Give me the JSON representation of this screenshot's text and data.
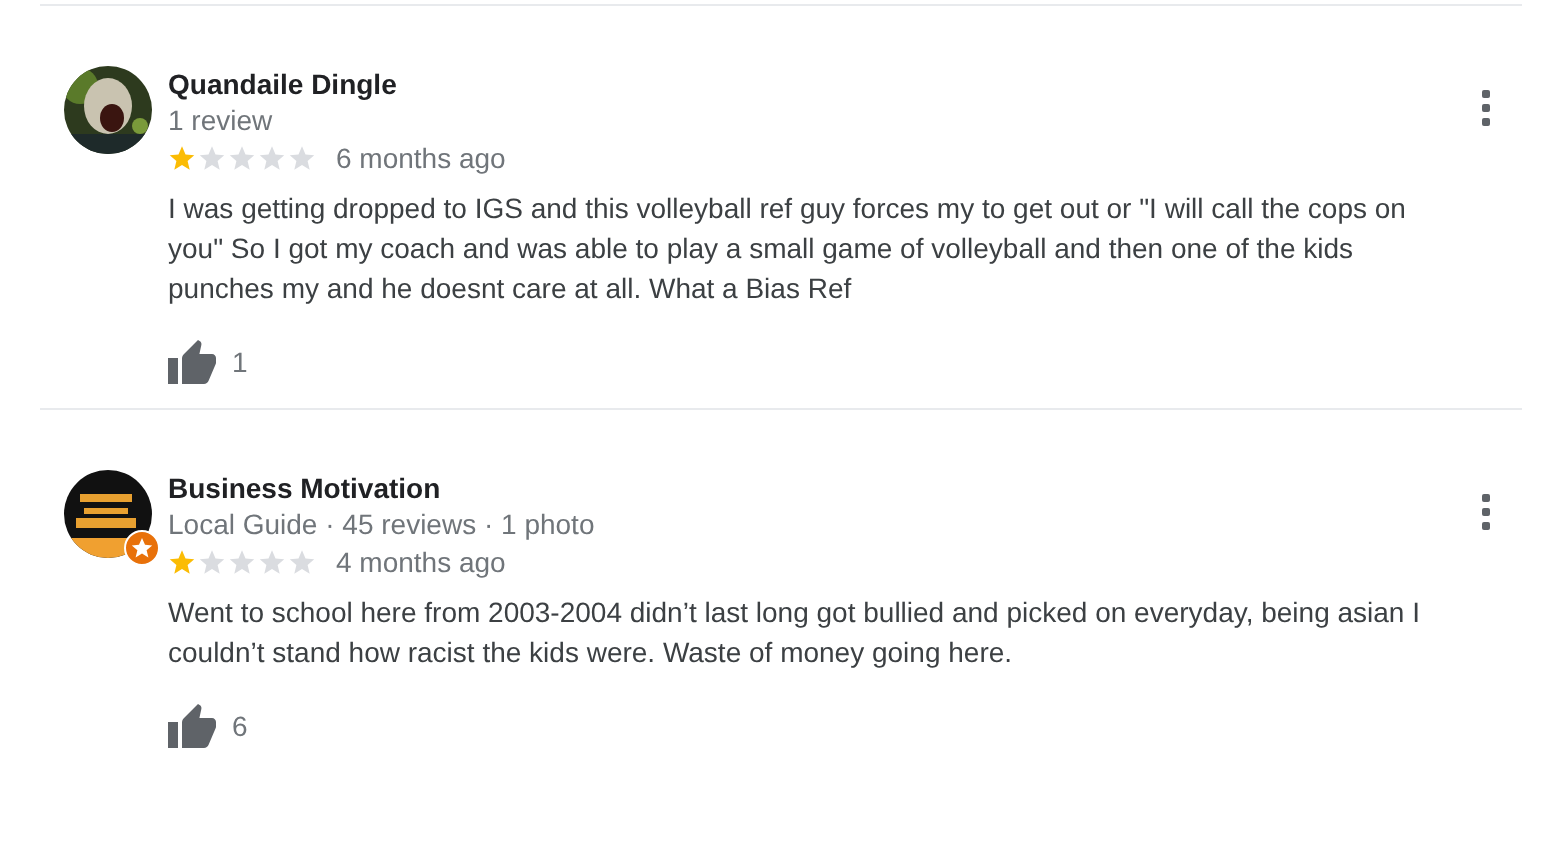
{
  "reviews": [
    {
      "author": "Quandaile Dingle",
      "meta": "1 review",
      "local_guide": false,
      "stars": 1,
      "time": "6 months ago",
      "text": "I was getting dropped to IGS and this volleyball ref guy forces my to get out or \"I will call the cops on you\" So I got my coach and was able to play a small game of volleyball and then one of the kids punches my and he doesnt care at all. What a Bias Ref",
      "likes": "1"
    },
    {
      "author": "Business Motivation",
      "meta": "Local Guide · 45 reviews · 1 photo",
      "local_guide": true,
      "stars": 1,
      "time": "4 months ago",
      "text": "Went to school here from 2003-2004 didn’t last long got bullied and picked on everyday, being asian I couldn’t stand how racist the kids were. Waste of money going here.",
      "likes": "6"
    }
  ]
}
